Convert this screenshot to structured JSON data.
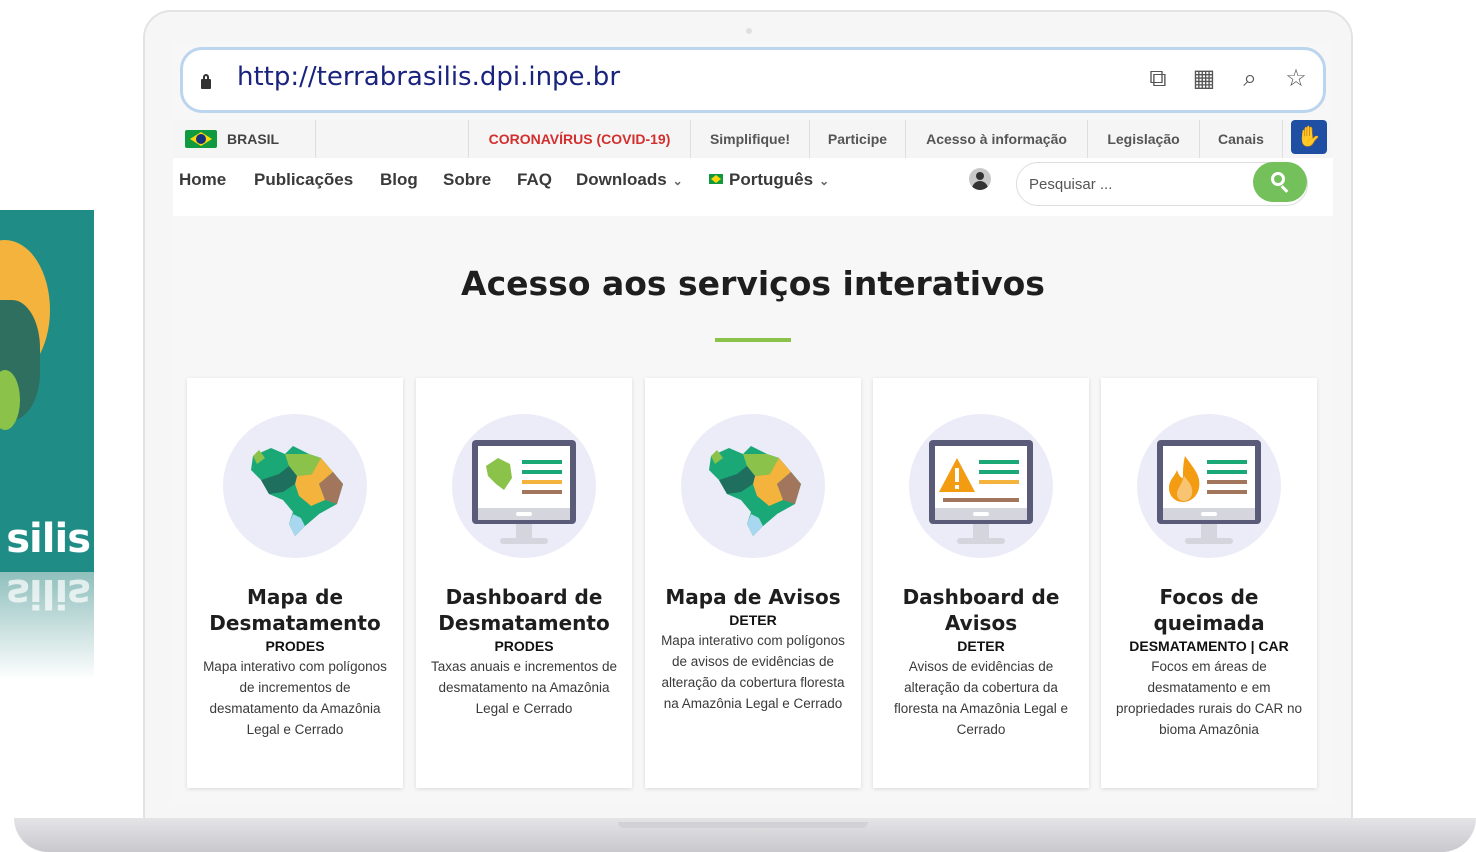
{
  "browser": {
    "url": "http://terrabrasilis.dpi.inpe.br",
    "actions": [
      "device-icon",
      "qr-code-icon",
      "zoom-icon",
      "bookmark-star-icon"
    ]
  },
  "gov_bar": {
    "country": "BRASIL",
    "items": [
      "CORONAVÍRUS (COVID-19)",
      "Simplifique!",
      "Participe",
      "Acesso à informação",
      "Legislação",
      "Canais"
    ],
    "accent_red": "#d32f2f"
  },
  "nav": {
    "items": [
      "Home",
      "Publicações",
      "Blog",
      "Sobre",
      "FAQ",
      "Downloads"
    ],
    "language": "Português",
    "search_placeholder": "Pesquisar ..."
  },
  "main": {
    "title": "Acesso aos serviços interativos",
    "accent_green": "#8bc34a",
    "cards": [
      {
        "title": "Mapa de Desmatamento",
        "subtitle": "PRODES",
        "description": "Mapa interativo com polígonos de incrementos de desmatamento da Amazônia Legal e Cerrado",
        "icon": "brazil-map-icon"
      },
      {
        "title": "Dashboard de Desmatamento",
        "subtitle": "PRODES",
        "description": "Taxas anuais e incrementos de desmatamento na Amazônia Legal e Cerrado",
        "icon": "monitor-map-icon"
      },
      {
        "title": "Mapa de Avisos",
        "subtitle": "DETER",
        "description": "Mapa interativo com polígonos de avisos de evidências de alteração da cobertura floresta na Amazônia Legal e Cerrado",
        "icon": "brazil-map-icon"
      },
      {
        "title": "Dashboard de Avisos",
        "subtitle": "DETER",
        "description": "Avisos de evidências de alteração da cobertura da floresta na Amazônia Legal e Cerrado",
        "icon": "monitor-warning-icon"
      },
      {
        "title": "Focos de queimada",
        "subtitle": "DESMATAMENTO | CAR",
        "description": "Focos em áreas de desmatamento e em propriedades rurais do CAR no bioma Amazônia",
        "icon": "monitor-fire-icon"
      }
    ]
  },
  "background_logo": {
    "text": "silis"
  }
}
